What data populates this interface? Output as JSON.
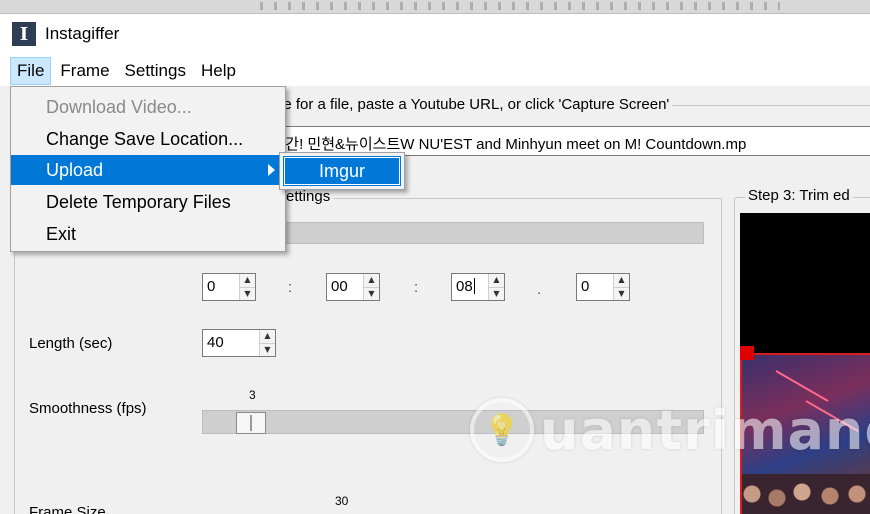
{
  "window": {
    "title": "Instagiffer",
    "icon_letter": "I"
  },
  "menubar": {
    "items": [
      "File",
      "Frame",
      "Settings",
      "Help"
    ]
  },
  "file_menu": {
    "items": [
      {
        "label": "Download Video...",
        "disabled": true
      },
      {
        "label": "Change Save Location..."
      },
      {
        "label": "Upload",
        "selected": true,
        "has_submenu": true
      },
      {
        "label": "Delete Temporary Files"
      },
      {
        "label": "Exit"
      }
    ],
    "submenu": {
      "items": [
        "Imgur"
      ]
    }
  },
  "step1": {
    "label_partial": "wse for a file, paste a Youtube URL, or click 'Capture Screen'",
    "url_value": "l 순간! 민현&뉴이스트W NU'EST and Minhyun meet on M! Countdown.mp"
  },
  "step2": {
    "title_partial": "ettings"
  },
  "start_time": {
    "h": "0",
    "m": "00",
    "s": "08",
    "ms": "0",
    "sep_colon": ":",
    "sep_dot": "."
  },
  "length": {
    "label": "Length (sec)",
    "value": "40"
  },
  "smoothness": {
    "label": "Smoothness (fps)",
    "value": "3",
    "value_fraction": 0.05
  },
  "frame_size": {
    "label": "Frame Size",
    "value": "30"
  },
  "step3": {
    "title_partial": "Step 3: Trim ed"
  },
  "watermark": {
    "text": "uantrimang",
    "icon": "lightbulb-icon"
  },
  "colors": {
    "highlight": "#0078d7",
    "menu_active": "#cce8ff",
    "handle": "#e00000"
  }
}
